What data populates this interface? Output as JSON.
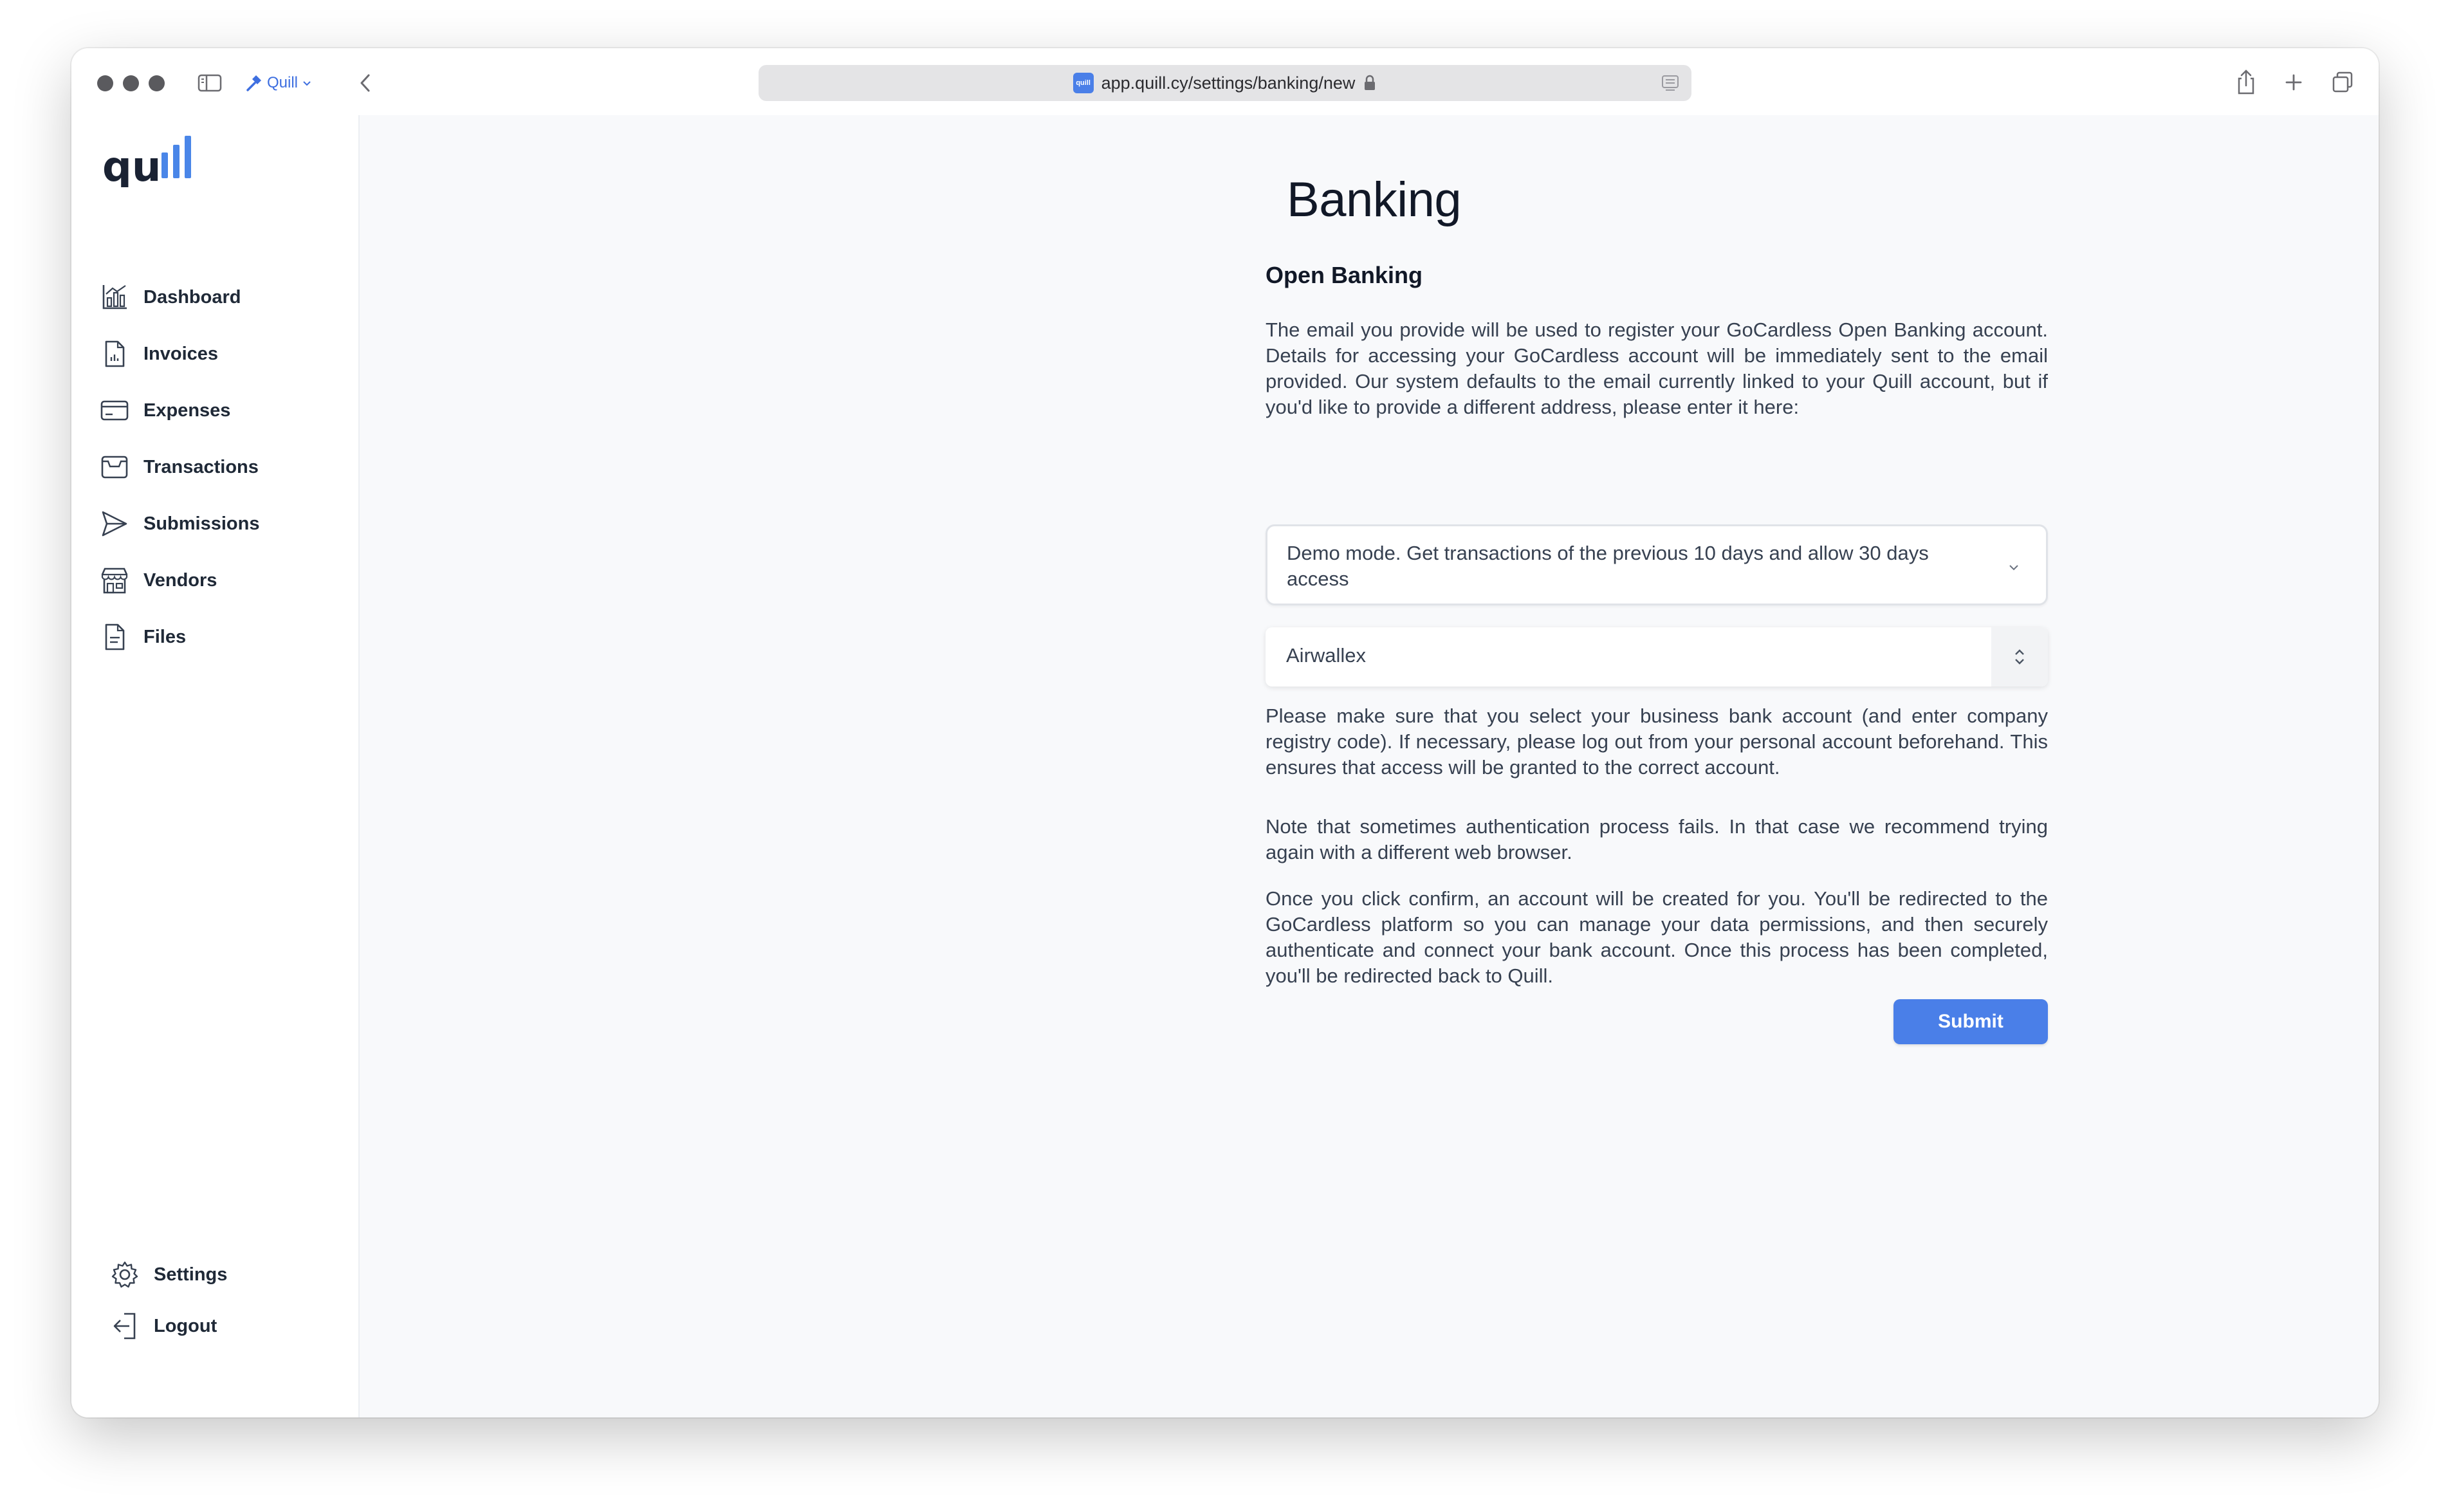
{
  "browser": {
    "profile_name": "Quill",
    "url": "app.quill.cy/settings/banking/new",
    "favicon_text": "quill"
  },
  "sidebar": {
    "logo": "quill",
    "items": [
      {
        "label": "Dashboard",
        "icon": "chart-icon"
      },
      {
        "label": "Invoices",
        "icon": "invoice-icon"
      },
      {
        "label": "Expenses",
        "icon": "credit-card-icon"
      },
      {
        "label": "Transactions",
        "icon": "inbox-icon"
      },
      {
        "label": "Submissions",
        "icon": "send-icon"
      },
      {
        "label": "Vendors",
        "icon": "store-icon"
      },
      {
        "label": "Files",
        "icon": "file-icon"
      }
    ],
    "footer": [
      {
        "label": "Settings",
        "icon": "gear-icon"
      },
      {
        "label": "Logout",
        "icon": "logout-icon"
      }
    ]
  },
  "main": {
    "title": "Banking",
    "section_title": "Open Banking",
    "intro": "The email you provide will be used to register your GoCardless Open Banking account. Details for accessing your GoCardless account will be immediately sent to the email provided. Our system defaults to the email currently linked to your Quill account, but if you'd like to provide a different address, please enter it here:",
    "mode_select": "Demo mode. Get transactions of the previous 10 days and allow 30 days access",
    "bank_select": "Airwallex",
    "note_business": "Please make sure that you select your business bank account (and enter company registry code). If necessary, please log out from your personal account beforehand. This ensures that access will be granted to the correct account.",
    "note_auth": "Note that sometimes authentication process fails. In that case we recommend trying again with a different web browser.",
    "note_confirm": "Once you click confirm, an account will be created for you. You'll be redirected to the GoCardless platform so you can manage your data permissions, and then securely authenticate and connect your bank account. Once this process has been completed, you'll be redirected back to Quill.",
    "submit_label": "Submit"
  },
  "colors": {
    "accent": "#4a7fe8",
    "logo_dark": "#1a2233",
    "logo_blue": "#4a86e8"
  }
}
